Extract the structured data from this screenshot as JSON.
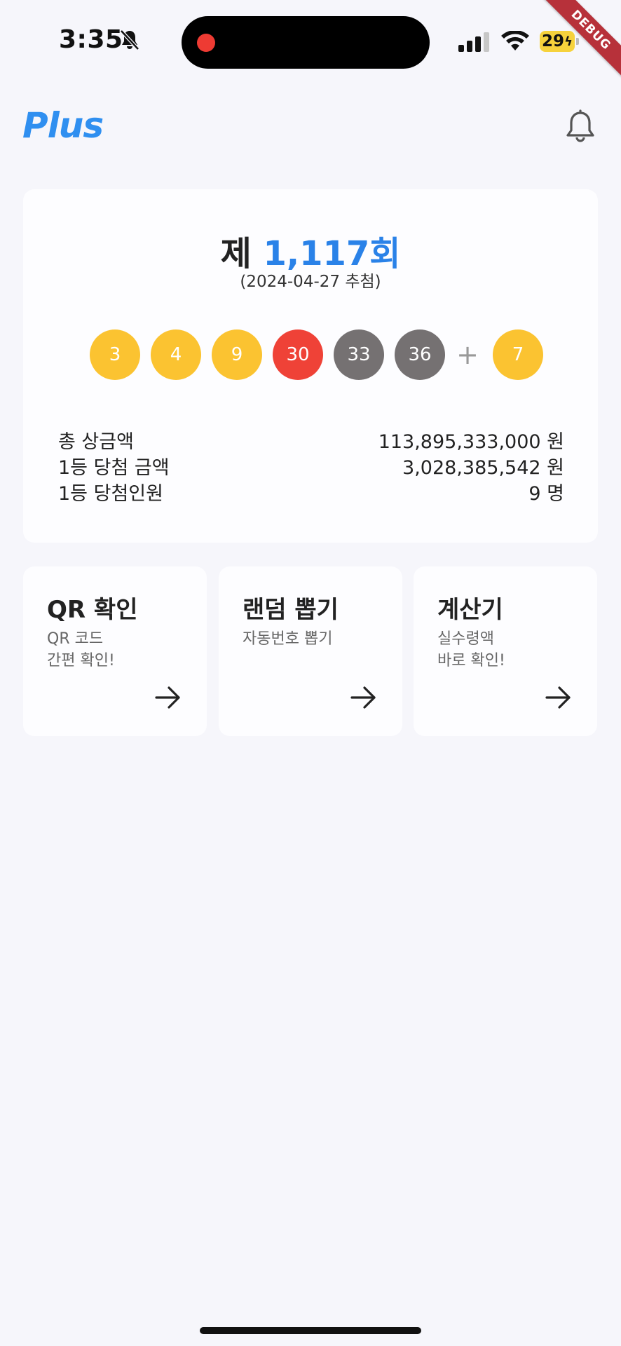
{
  "status_bar": {
    "time": "3:35",
    "battery": "29"
  },
  "debug_banner": "DEBUG",
  "app_bar": {
    "logo": "Plus"
  },
  "draw": {
    "round_prefix": "제 ",
    "round_number": "1,117",
    "round_suffix": "회",
    "date": "(2024-04-27 추첨)",
    "numbers": [
      {
        "value": "3",
        "color": "#fbc331"
      },
      {
        "value": "4",
        "color": "#fbc331"
      },
      {
        "value": "9",
        "color": "#fbc331"
      },
      {
        "value": "30",
        "color": "#ef4237"
      },
      {
        "value": "33",
        "color": "#757172"
      },
      {
        "value": "36",
        "color": "#757172"
      }
    ],
    "plus": "+",
    "bonus": {
      "value": "7",
      "color": "#fbc331"
    },
    "prizes": [
      {
        "label": "총 상금액",
        "value": "113,895,333,000 원"
      },
      {
        "label": "1등 당첨 금액",
        "value": "3,028,385,542 원"
      },
      {
        "label": "1등 당첨인원",
        "value": "9 명"
      }
    ]
  },
  "features": [
    {
      "title": "QR 확인",
      "desc": "QR 코드\n간편 확인!",
      "icon": "arrow-right-icon"
    },
    {
      "title": "랜덤 뽑기",
      "desc": "자동번호 뽑기",
      "icon": "arrow-right-icon"
    },
    {
      "title": "계산기",
      "desc": "실수령액\n바로 확인!",
      "icon": "arrow-right-icon"
    }
  ],
  "colors": {
    "accent": "#2a82e8",
    "logo": "#2f8ff0",
    "background": "#f6f6fb",
    "card": "#fdfdff"
  }
}
